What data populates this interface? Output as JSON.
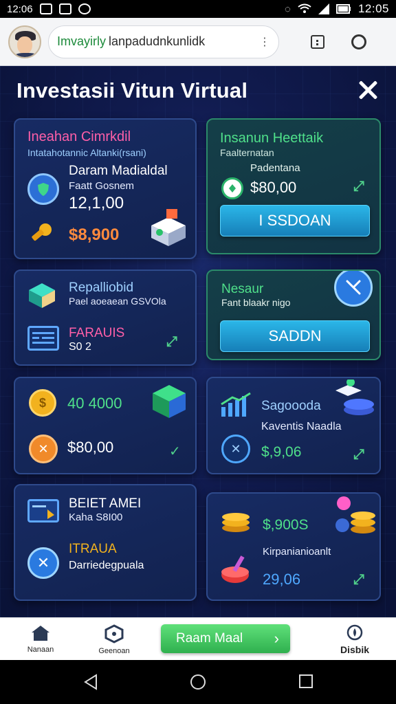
{
  "status_bar": {
    "left_time": "12:06",
    "time": "12:05"
  },
  "browser": {
    "url_domain": "Imvayirly",
    "url_path": "lanpadudnkunlidk",
    "url_dots": "⋮"
  },
  "header": {
    "title": "Investasii Vitun Virtual"
  },
  "cards": [
    {
      "title": "Ineahan Cimrkdil",
      "subtitle": "Intatahotannic Altanki(rsani)",
      "label": "Daram Madialdal",
      "sub": "Faatt Gosnem",
      "value": "12,1,00",
      "price": "$8,900"
    },
    {
      "title": "Insanun Heettaik",
      "subtitle": "Faalternatan",
      "label": "Padentana",
      "value": "$80,00",
      "button": "I SSDOAN"
    },
    {
      "title": "Repalliobid",
      "subtitle": "Pael aoeaean GSVOla",
      "label": "FARAUIS",
      "value": "S0 2"
    },
    {
      "title": "Nesaur",
      "subtitle": "Fant blaakr nigo",
      "button": "SADDN"
    },
    {
      "value": "40 4000",
      "price": "$80,00"
    },
    {
      "title": "Sagoooda",
      "subtitle": "Kaventis Naadla",
      "value": "$,9,06"
    },
    {
      "title": "BEIET AMEI",
      "subtitle": "Kaha S8I00",
      "label": "ITRAUA",
      "sub": "Darriedegpuala"
    },
    {
      "value": "$,900S",
      "label": "Kirpanianioanlt",
      "price": "29,06"
    }
  ],
  "bottom_nav": {
    "home": "Nanaan",
    "explore": "Geenoan",
    "start": "Raam Maal",
    "profile": "Disbik"
  },
  "colors": {
    "accent_green": "#4fd08a",
    "price_orange": "#ff8a3d",
    "title_pink": "#ff5fa8",
    "title_green": "#4fe08a"
  }
}
